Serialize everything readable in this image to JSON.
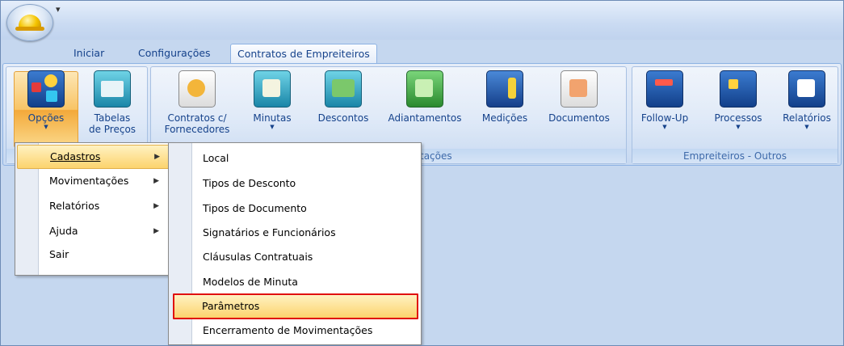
{
  "quick_access": "▾",
  "tabs": [
    "Iniciar",
    "Configurações",
    "Contratos de Empreiteiros"
  ],
  "ribbon": {
    "opcoes_label": "Opções",
    "tabelas_label1": "Tabelas",
    "tabelas_label2": "de Preços",
    "contratos_label1": "Contratos c/",
    "contratos_label2": "Fornecedores",
    "minutas_label": "Minutas",
    "descontos_label": "Descontos",
    "adiantamentos_label": "Adiantamentos",
    "medicoes_label": "Medições",
    "documentos_label": "Documentos",
    "followup_label": "Follow-Up",
    "processos_label": "Processos",
    "relatorios_label": "Relatórios",
    "group_mov_label": "entações",
    "group_outros_label": "Empreiteiros - Outros"
  },
  "menu_main": [
    "Cadastros",
    "Movimentações",
    "Relatórios",
    "Ajuda",
    "Sair"
  ],
  "menu_cadastros": [
    "Local",
    "Tipos de Desconto",
    "Tipos de Documento",
    "Signatários e Funcionários",
    "Cláusulas Contratuais",
    "Modelos de Minuta",
    "Parâmetros",
    "Encerramento de Movimentações"
  ],
  "arrow": "▶",
  "dropdown_arrow": "▼"
}
